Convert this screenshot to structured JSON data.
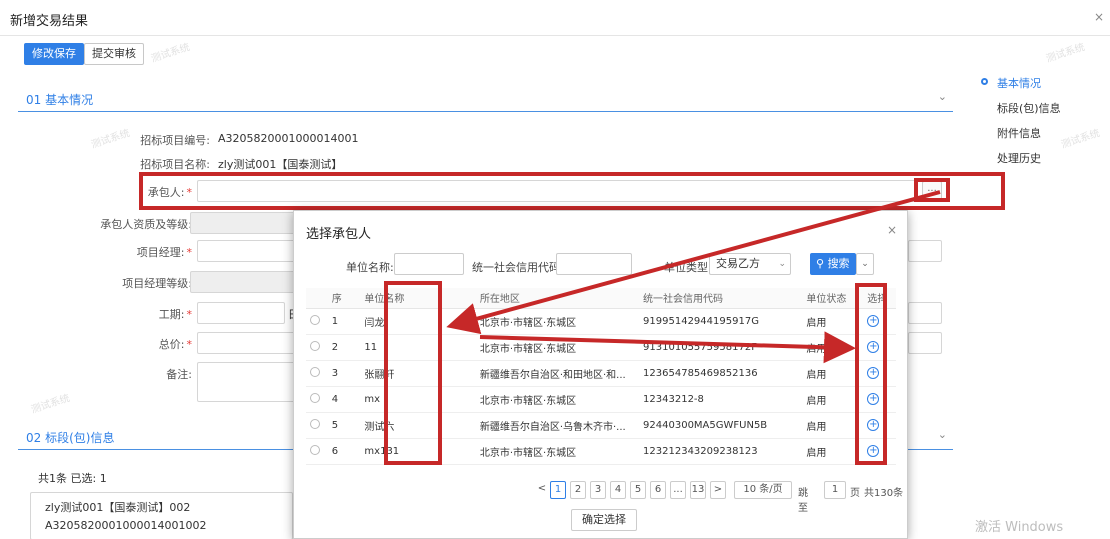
{
  "window": {
    "title": "新增交易结果",
    "close": "×"
  },
  "toolbar": {
    "save": "修改保存",
    "submit": "提交审核"
  },
  "section1": {
    "title": "01 基本情况",
    "chevron": "⌄"
  },
  "form": {
    "project_code_label": "招标项目编号:",
    "project_code_value": "A3205820001000014001",
    "project_name_label": "招标项目名称:",
    "project_name_value": "zly测试001【国泰测试】",
    "contractor_label": "承包人:",
    "qualification_label": "承包人资质及等级:",
    "manager_label": "项目经理:",
    "manager_level_label": "项目经理等级:",
    "period_label": "工期:",
    "period_unit": "日",
    "total_label": "总价:",
    "remark_label": "备注:",
    "dots": "..."
  },
  "section2": {
    "title": "02 标段(包)信息",
    "summary": "共1条  已选: 1",
    "item_name": "zly测试001【国泰测试】002",
    "item_code": "A3205820001000014001002"
  },
  "rightnav": {
    "items": [
      "基本情况",
      "标段(包)信息",
      "附件信息",
      "处理历史"
    ]
  },
  "modal": {
    "title": "选择承包人",
    "close": "×",
    "unit_name_label": "单位名称:",
    "credit_code_label": "统一社会信用代码:",
    "unit_type_label": "单位类型:",
    "unit_type_value": "交易乙方",
    "search": "搜索",
    "columns": [
      "序",
      "单位名称",
      "所在地区",
      "统一社会信用代码",
      "单位状态",
      "选择"
    ],
    "rows": [
      {
        "no": "1",
        "name": "闫龙",
        "area": "北京市·市辖区·东城区",
        "code": "91995142944195917G",
        "status": "启用"
      },
      {
        "no": "2",
        "name": "11",
        "area": "北京市·市辖区·东城区",
        "code": "91310105575958172F",
        "status": "启用"
      },
      {
        "no": "3",
        "name": "张翮轩",
        "area": "新疆维吾尔自治区·和田地区·和...",
        "code": "123654785469852136",
        "status": "启用"
      },
      {
        "no": "4",
        "name": "mx",
        "area": "北京市·市辖区·东城区",
        "code": "12343212-8",
        "status": "启用"
      },
      {
        "no": "5",
        "name": "测试六",
        "area": "新疆维吾尔自治区·乌鲁木齐市·...",
        "code": "92440300MA5GWFUN5B",
        "status": "启用"
      },
      {
        "no": "6",
        "name": "mx131",
        "area": "北京市·市辖区·东城区",
        "code": "123212343209238123",
        "status": "启用"
      }
    ],
    "pager": {
      "prev": "<",
      "pages": [
        "1",
        "2",
        "3",
        "4",
        "5",
        "6",
        "...",
        "13"
      ],
      "next": ">",
      "page_size": "10 条/页",
      "jump_label": "跳至",
      "jump_value": "1",
      "page_unit": "页",
      "total": "共130条"
    },
    "confirm": "确定选择"
  },
  "watermark": "测试系统",
  "os_watermark": "激活 Windows",
  "colors": {
    "accent": "#2f7fe6",
    "annotation": "#c62828"
  }
}
